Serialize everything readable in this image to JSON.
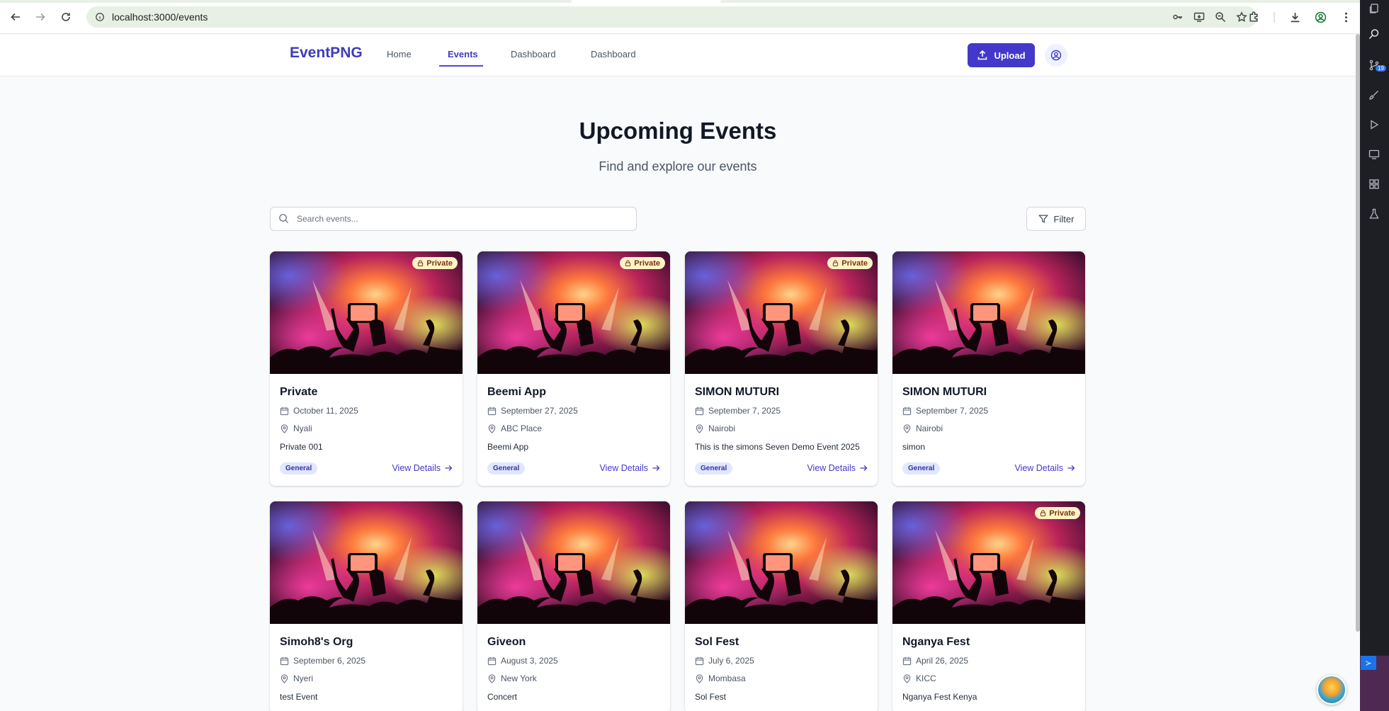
{
  "browser": {
    "url": "localhost:3000/events"
  },
  "app": {
    "brand": "EventPNG",
    "nav": [
      {
        "label": "Home",
        "active": false
      },
      {
        "label": "Events",
        "active": true
      },
      {
        "label": "Dashboard",
        "active": false
      },
      {
        "label": "Dashboard",
        "active": false
      }
    ],
    "upload_label": "Upload"
  },
  "page": {
    "title": "Upcoming Events",
    "subtitle": "Find and explore our events",
    "search_placeholder": "Search events...",
    "filter_label": "Filter"
  },
  "events": [
    {
      "title": "Private",
      "date": "October 11, 2025",
      "location": "Nyali",
      "description": "Private 001",
      "category": "General",
      "private": true,
      "view_label": "View Details"
    },
    {
      "title": "Beemi App",
      "date": "September 27, 2025",
      "location": "ABC Place",
      "description": "Beemi App",
      "category": "General",
      "private": true,
      "view_label": "View Details"
    },
    {
      "title": "SIMON MUTURI",
      "date": "September 7, 2025",
      "location": "Nairobi",
      "description": "This is the simons Seven Demo Event 2025",
      "category": "General",
      "private": true,
      "view_label": "View Details"
    },
    {
      "title": "SIMON MUTURI",
      "date": "September 7, 2025",
      "location": "Nairobi",
      "description": "simon",
      "category": "General",
      "private": false,
      "view_label": "View Details"
    },
    {
      "title": "Simoh8's Org",
      "date": "September 6, 2025",
      "location": "Nyeri",
      "description": "test Event",
      "category": "",
      "private": false,
      "view_label": ""
    },
    {
      "title": "Giveon",
      "date": "August 3, 2025",
      "location": "New York",
      "description": "Concert",
      "category": "",
      "private": false,
      "view_label": ""
    },
    {
      "title": "Sol Fest",
      "date": "July 6, 2025",
      "location": "Mombasa",
      "description": "Sol Fest",
      "category": "",
      "private": false,
      "view_label": ""
    },
    {
      "title": "Nganya Fest",
      "date": "April 26, 2025",
      "location": "KICC",
      "description": "Nganya Fest Kenya",
      "category": "",
      "private": true,
      "view_label": ""
    }
  ],
  "private_label": "Private",
  "side_panel": {
    "badge_count": "19"
  },
  "colors": {
    "brand": "#3f3cbb",
    "primary": "#4338ca",
    "badge_private_bg": "#fef3c7",
    "badge_category_bg": "#e0e7ff"
  },
  "icons": [
    "back-icon",
    "forward-icon",
    "reload-icon",
    "site-info-icon",
    "password-key-icon",
    "install-app-icon",
    "zoom-icon",
    "star-icon",
    "extensions-icon",
    "download-icon",
    "profile-icon",
    "more-icon",
    "upload-icon",
    "user-icon",
    "search-icon",
    "filter-icon",
    "lock-icon",
    "calendar-icon",
    "map-pin-icon",
    "arrow-right-icon"
  ]
}
